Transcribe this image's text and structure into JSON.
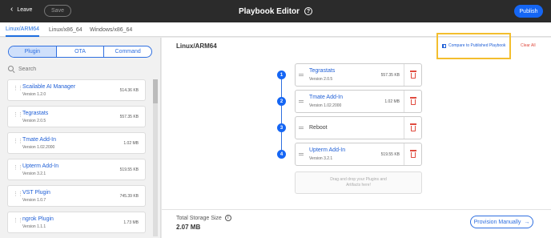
{
  "header": {
    "leave_label": "Leave",
    "save_label": "Save",
    "title": "Playbook Editor",
    "publish_label": "Publish"
  },
  "tabs": [
    {
      "label": "Linux/ARM64",
      "active": true
    },
    {
      "label": "Linux/x86_64",
      "active": false
    },
    {
      "label": "Windows/x86_64",
      "active": false
    }
  ],
  "segments": [
    {
      "label": "Plugin",
      "active": true
    },
    {
      "label": "OTA",
      "active": false
    },
    {
      "label": "Command",
      "active": false
    }
  ],
  "search": {
    "placeholder": "Search"
  },
  "plugins": [
    {
      "name": "Scailable AI Manager",
      "version": "Version 1.2.0",
      "size": "514.36 KB"
    },
    {
      "name": "Tegrastats",
      "version": "Version 2.0.5",
      "size": "557.35 KB"
    },
    {
      "name": "Tmate Add-In",
      "version": "Version 1.02.2000",
      "size": "1.02 MB"
    },
    {
      "name": "Upterm Add-In",
      "version": "Version 3.2.1",
      "size": "519.55 KB"
    },
    {
      "name": "VST Plugin",
      "version": "Version 1.0.7",
      "size": "745.39 KB"
    },
    {
      "name": "ngrok Plugin",
      "version": "Version 1.1.1",
      "size": "1.73 MB"
    }
  ],
  "main": {
    "arch_title": "Linux/ARM64",
    "compare_label": "Compare to Published Playbook",
    "clear_label": "Clear All",
    "steps": [
      {
        "num": "1",
        "name": "Tegrastats",
        "version": "Version 2.0.5",
        "size": "557.35 KB"
      },
      {
        "num": "2",
        "name": "Tmate Add-In",
        "version": "Version 1.02.2000",
        "size": "1.02 MB"
      },
      {
        "num": "3",
        "name": "Reboot",
        "version": "",
        "size": ""
      },
      {
        "num": "4",
        "name": "Upterm Add-In",
        "version": "Version 3.2.1",
        "size": "519.55 KB"
      }
    ],
    "dropzone_text": "Drag and drop your Plugins and Artifacts here!",
    "storage_label": "Total Storage Size",
    "storage_value": "2.07 MB",
    "provision_label": "Provision Manually"
  },
  "colors": {
    "accent": "#1566f4",
    "danger": "#e04b3f",
    "highlight": "#f3be2e",
    "topbar": "#2b2b2b"
  }
}
